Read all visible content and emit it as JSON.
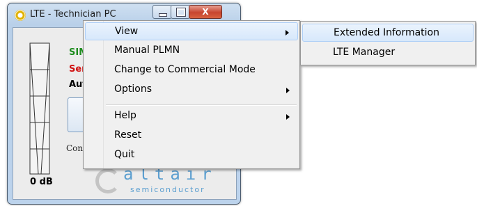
{
  "window": {
    "title": "LTE - Technician PC",
    "signal_label": "0 dB",
    "sim_text": "SIM",
    "service_text": "Serv",
    "auto_text": "Auto",
    "conn_text": "Conn",
    "logo_text": "altair",
    "logo_sub": "semiconductor",
    "close_glyph": "X"
  },
  "menu": {
    "items": [
      {
        "label": "View",
        "submenu": true,
        "highlighted": true
      },
      {
        "label": "Manual PLMN"
      },
      {
        "label": "Change to Commercial Mode"
      },
      {
        "label": "Options",
        "submenu": true
      },
      {
        "label": "Help",
        "submenu": true
      },
      {
        "label": "Reset"
      },
      {
        "label": "Quit"
      }
    ]
  },
  "submenu": {
    "items": [
      {
        "label": "Extended Information",
        "highlighted": true
      },
      {
        "label": "LTE Manager"
      }
    ]
  },
  "colors": {
    "sim": "#1e8c1e",
    "service": "#d01010",
    "highlight": "#d7e8fb",
    "logo": "#5c9fd0"
  }
}
